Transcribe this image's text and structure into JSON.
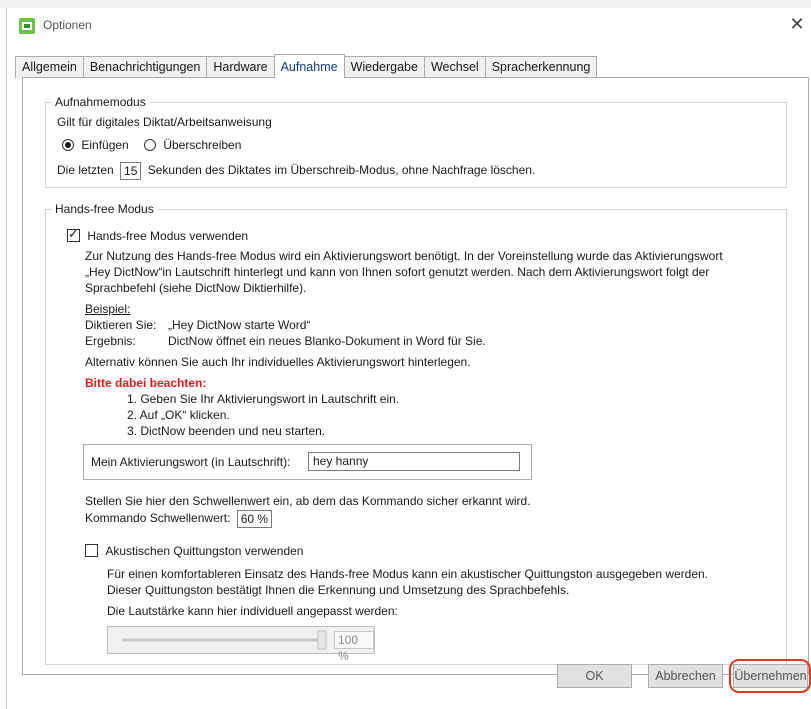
{
  "window": {
    "title": "Optionen",
    "close_symbol": "✕"
  },
  "tabs": [
    {
      "label": "Allgemein",
      "active": false
    },
    {
      "label": "Benachrichtigungen",
      "active": false
    },
    {
      "label": "Hardware",
      "active": false
    },
    {
      "label": "Aufnahme",
      "active": true
    },
    {
      "label": "Wiedergabe",
      "active": false
    },
    {
      "label": "Wechsel",
      "active": false
    },
    {
      "label": "Spracherkennung",
      "active": false
    }
  ],
  "aufnahmemodus": {
    "legend": "Aufnahmemodus",
    "subtitle": "Gilt für digitales Diktat/Arbeitsanweisung",
    "radio_insert": "Einfügen",
    "radio_overwrite": "Überschreiben",
    "selected": "Einfügen",
    "delete_prefix": "Die letzten",
    "delete_seconds": "15",
    "delete_suffix": "Sekunden des Diktates im Überschreib-Modus, ohne Nachfrage löschen."
  },
  "handsfree": {
    "legend": "Hands-free Modus",
    "use_label": "Hands-free Modus verwenden",
    "use_checked": true,
    "desc_line1": "Zur Nutzung des Hands-free Modus wird ein Aktivierungswort benötigt. In der Voreinstellung wurde das Aktivierungswort",
    "desc_line2": "„Hey DictNow“in Lautschrift hinterlegt und kann von Ihnen sofort genutzt werden. Nach dem Aktivierungswort folgt der",
    "desc_line3": "Sprachbefehl (siehe DictNow Diktierhilfe).",
    "example_heading": "Beispiel:",
    "dictate_label": "Diktieren Sie:",
    "dictate_value": "„Hey DictNow starte Word“",
    "result_label": "Ergebnis:",
    "result_value": "DictNow öffnet ein neues Blanko-Dokument in Word für Sie.",
    "alternative": "Alternativ können Sie auch Ihr individuelles Aktivierungswort hinterlegen.",
    "note_heading": "Bitte dabei beachten:",
    "steps": [
      "1. Geben Sie Ihr Aktivierungswort in Lautschrift ein.",
      "2. Auf „OK“ klicken.",
      "3. DictNow beenden und neu starten."
    ],
    "wakeword_label": "Mein Aktivierungswort (in Lautschrift):",
    "wakeword_value": "hey hanny",
    "threshold_desc": "Stellen Sie hier den Schwellenwert ein, ab dem das Kommando sicher erkannt wird.",
    "threshold_label": "Kommando Schwellenwert:",
    "threshold_value": "60 %",
    "ack_label": "Akustischen Quittungston verwenden",
    "ack_checked": false,
    "ack_desc1": "Für einen komfortableren Einsatz des Hands-free Modus kann ein akustischer Quittungston ausgegeben werden.",
    "ack_desc2": "Dieser Quittungston bestätigt Ihnen die Erkennung und Umsetzung des Sprachbefehls.",
    "volume_label": "Die Lautstärke kann hier individuell angepasst werden:",
    "volume_value": "100 %",
    "volume_level": 1.0
  },
  "buttons": {
    "ok": "OK",
    "cancel": "Abbrechen",
    "apply": "Übernehmen"
  },
  "colors": {
    "note_red": "#e41b1b",
    "highlight_ring": "#e03a1e",
    "active_tab_text": "#0e3b85"
  }
}
